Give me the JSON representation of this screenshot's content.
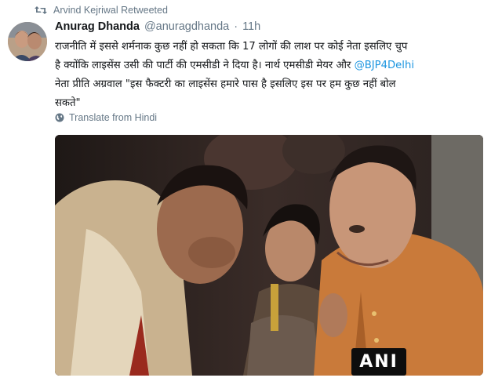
{
  "retweet": {
    "text": "Arvind Kejriwal Retweeted",
    "icon": "retweet-icon"
  },
  "author": {
    "name": "Anurag Dhanda",
    "handle": "@anuragdhanda",
    "separator": "·",
    "time": "11h"
  },
  "tweet": {
    "line1": "राजनीति में इससे शर्मनाक कुछ नहीं हो सकता कि 17 लोगों की लाश पर कोई नेता इसलिए चुप",
    "line2a": "है क्योंकि लाइसेंस उसी की पार्टी की एमसीडी ने दिया है। नार्थ एमसीडी मेयर और ",
    "mention": "@BJP4Delhi",
    "line3": "नेता प्रीति अग्रवाल \"इस फैक्टरी का लाइसेंस हमारे पास है इसलिए इस पर हम कुछ नहीं बोल",
    "line4": "सकते\""
  },
  "translate": {
    "label": "Translate from Hindi",
    "icon": "globe-icon"
  },
  "media": {
    "logo_text": "ANI"
  },
  "colors": {
    "link": "#1b95e0",
    "muted": "#657786",
    "text": "#14171a"
  }
}
